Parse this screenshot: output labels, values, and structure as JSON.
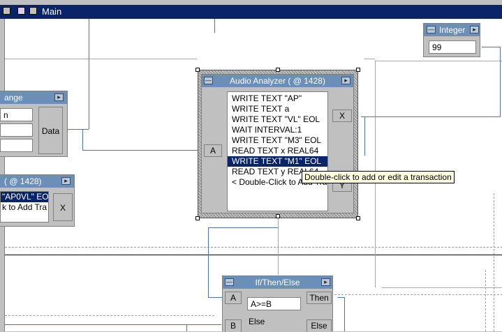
{
  "window": {
    "title": "Main"
  },
  "integer_box": {
    "title": "Integer",
    "value": "99"
  },
  "range_box": {
    "title": "ange",
    "rows": [
      "n",
      "",
      ""
    ],
    "output_label": "Data"
  },
  "analyzer_small": {
    "title": "( @ 1428)",
    "rows": [
      "\"AP0VL\" EO",
      "k to Add Tra"
    ],
    "output_label": "X"
  },
  "audio_analyzer": {
    "title": "Audio Analyzer ( @ 1428)",
    "input_label": "A",
    "outputs": [
      "X",
      "Y"
    ],
    "transactions": [
      "WRITE TEXT \"AP\"",
      "WRITE TEXT a",
      "WRITE TEXT \"VL\" EOL",
      "WAIT INTERVAL:1",
      "WRITE TEXT \"M3\" EOL",
      "READ TEXT x REAL64",
      "WRITE TEXT \"M1\" EOL",
      "READ TEXT y REAL64",
      "< Double-Click to Add Tra"
    ],
    "selected_index": 6
  },
  "tooltip": {
    "text": "Double-click to add or edit a transaction"
  },
  "if_then_else": {
    "title": "If/Then/Else",
    "inputs": [
      "A",
      "B"
    ],
    "condition": "A>=B",
    "else_label": "Else",
    "outputs": [
      "Then",
      "Else"
    ]
  },
  "colors": {
    "title_bar": "#0a246a",
    "object_header": "#6b8fb6",
    "wire": "#4a76b0",
    "selection": "#0a246a"
  }
}
